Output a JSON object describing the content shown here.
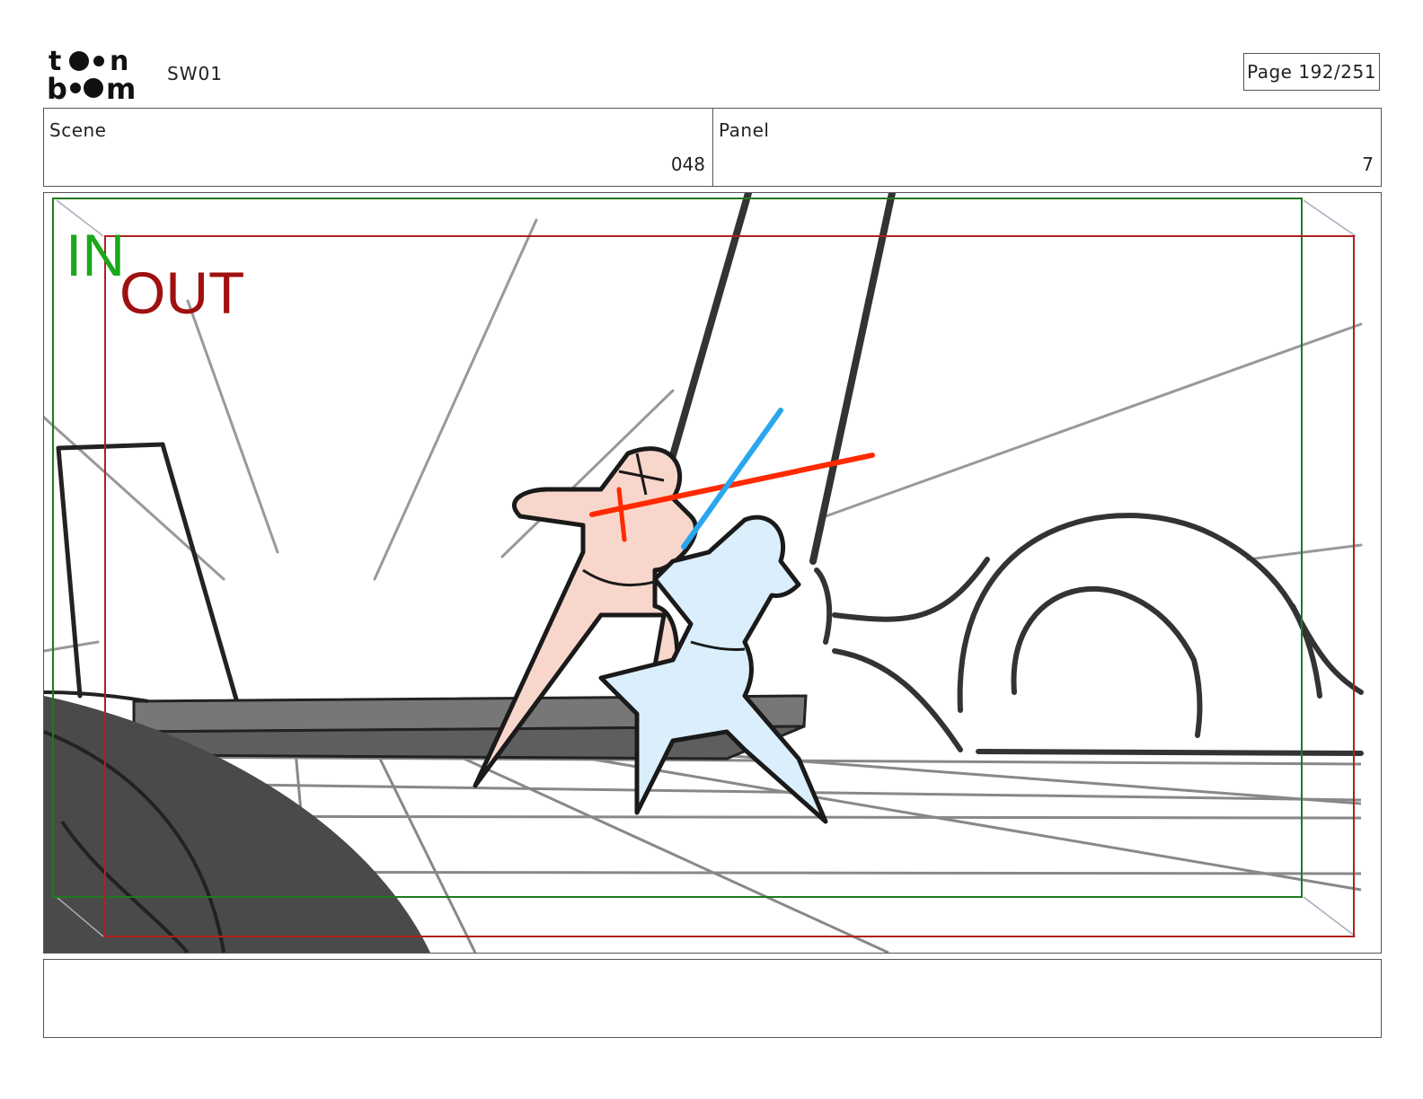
{
  "header": {
    "logo_text": "toon boom",
    "project": "SW01",
    "page": "Page 192/251"
  },
  "info": {
    "scene_label": "Scene",
    "scene_value": "048",
    "panel_label": "Panel",
    "panel_value": "7"
  },
  "frame": {
    "in_label": "IN",
    "out_label": "OUT",
    "colors": {
      "in": "#1aa81a",
      "out": "#a01010",
      "red_saber": "#ff2a00",
      "blue_saber": "#2aa6ee",
      "figure_red": "#f8d6cc",
      "figure_blue": "#dbeefc"
    }
  },
  "notes": {
    "text": ""
  }
}
